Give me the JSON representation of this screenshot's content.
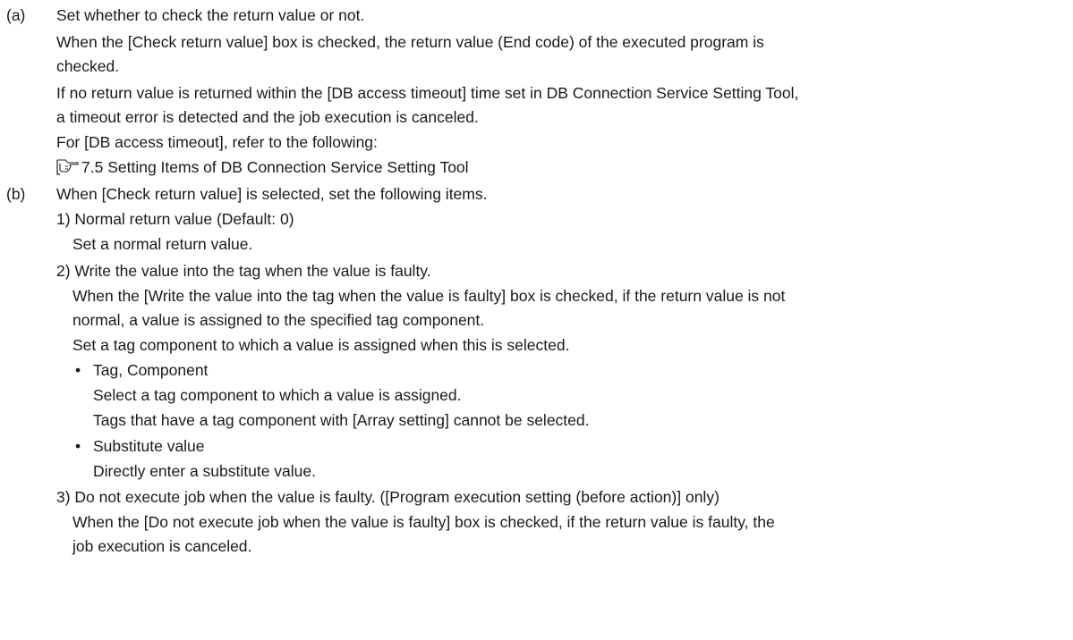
{
  "section_a": {
    "marker": "(a)",
    "title": "Set whether to check the return value or not.",
    "p1_line1": "When the [Check return value] box is checked, the return value (End code) of the executed program is",
    "p1_line2": "checked.",
    "p2_line1": "If no return value is returned within the [DB access timeout] time set in DB Connection Service Setting Tool,",
    "p2_line2": "a timeout error is detected and the job execution is canceled.",
    "p3": "For [DB access timeout], refer to the following:",
    "ref_icon": "reference-hand-icon",
    "ref_text": "7.5 Setting Items of DB Connection Service Setting Tool"
  },
  "section_b": {
    "marker": "(b)",
    "title": "When [Check return value] is selected, set the following items.",
    "item1": {
      "title": "1) Normal return value (Default: 0)",
      "desc": "Set a normal return value."
    },
    "item2": {
      "title": "2) Write the value into the tag when the value is faulty.",
      "desc_line1": "When the [Write the value into the tag when the value is faulty] box is checked, if the return value is not",
      "desc_line2": "normal, a value is assigned to the specified tag component.",
      "desc_line3": "Set a tag component to which a value is assigned when this is selected.",
      "bullet_char": "•",
      "bullet1_title": "Tag, Component",
      "bullet1_line1": "Select a tag component to which a value is assigned.",
      "bullet1_line2": "Tags that have a tag component with [Array setting] cannot be selected.",
      "bullet2_title": "Substitute value",
      "bullet2_line1": "Directly enter a substitute value."
    },
    "item3": {
      "title": "3) Do not execute job when the value is faulty. ([Program execution setting (before action)] only)",
      "desc_line1": "When the [Do not execute job when the value is faulty] box is checked, if the return value is faulty, the",
      "desc_line2": "job execution is canceled."
    }
  }
}
